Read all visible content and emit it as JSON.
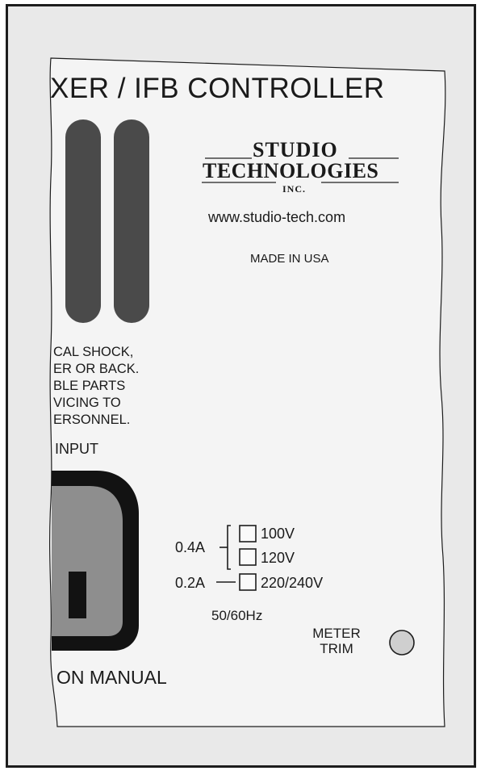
{
  "panel": {
    "title": "XER / IFB CONTROLLER",
    "logo": {
      "line1": "STUDIO",
      "line2": "TECHNOLOGIES",
      "line3": "INC."
    },
    "website": "www.studio-tech.com",
    "origin": "MADE IN USA",
    "warning_lines": [
      "CAL SHOCK,",
      "ER OR BACK.",
      "BLE PARTS",
      "VICING TO",
      "ERSONNEL."
    ],
    "input_label": "INPUT",
    "manual_text": "ON MANUAL",
    "fuse_current_high": "0.4A",
    "fuse_current_low": "0.2A",
    "voltages": [
      "100V",
      "120V",
      "220/240V"
    ],
    "frequency": "50/60Hz",
    "meter_trim": {
      "line1": "METER",
      "line2": "TRIM"
    }
  },
  "colors": {
    "panel_bg": "#e9e9e9",
    "label_bg": "#f3f3f3",
    "vent": "#4a4a4a",
    "connector_dark": "#121212",
    "connector_gray": "#8e8e8e"
  }
}
